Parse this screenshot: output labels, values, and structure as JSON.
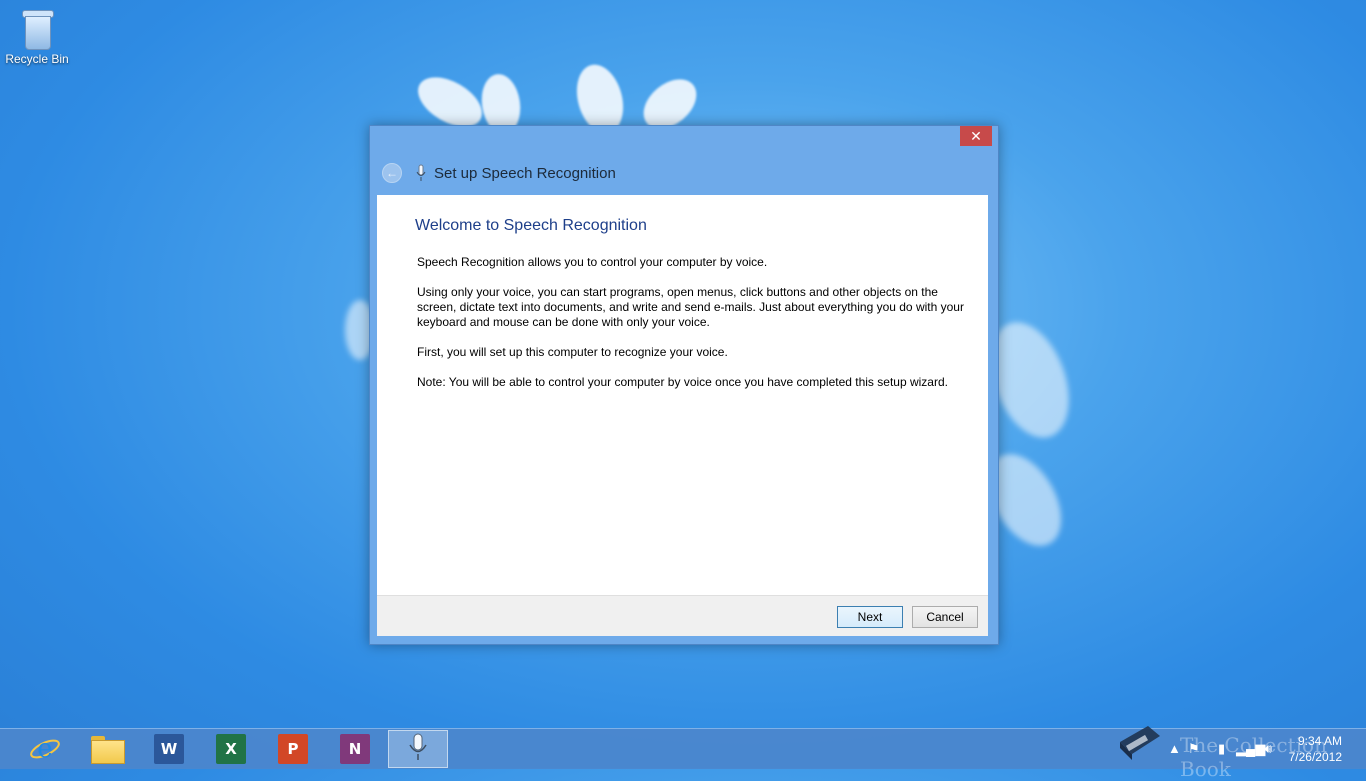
{
  "desktop": {
    "icons": [
      {
        "label": "Recycle Bin",
        "icon": "recycle-bin-icon"
      }
    ]
  },
  "dialog": {
    "title": "Set up Speech Recognition",
    "close_glyph": "✕",
    "back_glyph": "←",
    "heading": "Welcome to Speech Recognition",
    "paragraphs": [
      "Speech Recognition allows you to control your computer by voice.",
      "Using only your voice, you can start programs, open menus, click buttons and other objects on the screen, dictate text into documents, and write and send e-mails. Just about everything you do with your keyboard and mouse can be done with only your voice.",
      "First, you will set up this computer to recognize your voice.",
      "Note: You will be able to control your computer by voice once you have completed this setup wizard."
    ],
    "next_label": "Next",
    "cancel_label": "Cancel"
  },
  "taskbar": {
    "apps": [
      {
        "name": "internet-explorer",
        "glyph": "e",
        "color": "#1e88e5"
      },
      {
        "name": "file-explorer",
        "glyph": "",
        "color": "#f2c94c"
      },
      {
        "name": "word",
        "glyph": "W",
        "color": "#2b579a"
      },
      {
        "name": "excel",
        "glyph": "X",
        "color": "#217346"
      },
      {
        "name": "powerpoint",
        "glyph": "P",
        "color": "#d24726"
      },
      {
        "name": "onenote",
        "glyph": "N",
        "color": "#80397b"
      },
      {
        "name": "speech-recognition",
        "glyph": "",
        "color": "#ffffff"
      }
    ],
    "clock_time": "9:34 AM",
    "clock_date": "7/26/2012",
    "watermark": "The Collection Book"
  }
}
